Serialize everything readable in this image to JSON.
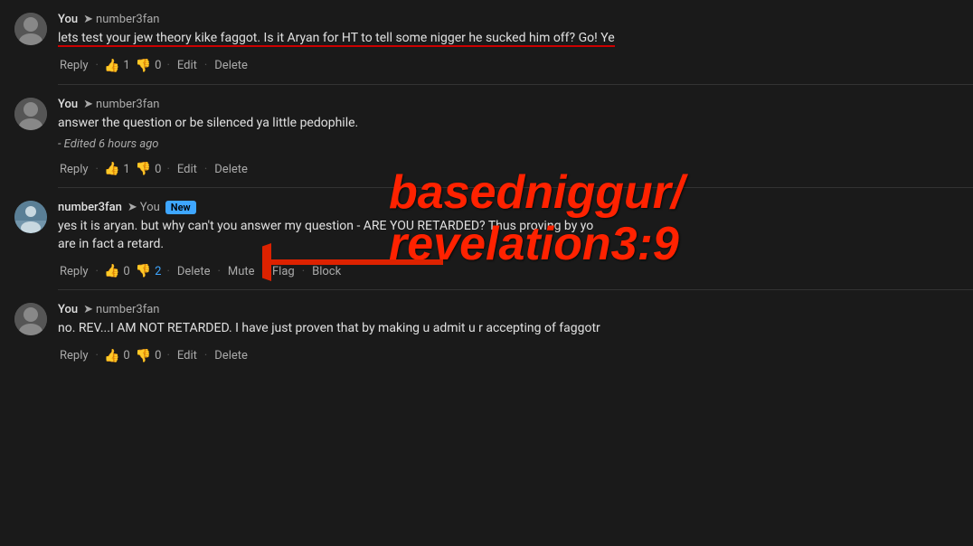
{
  "comments": [
    {
      "id": "comment-1",
      "username": "You",
      "reply_to": "number3fan",
      "text": "lets test your jew theory kike faggot. Is it Aryan for HT to tell some nigger he sucked him off? Go! Ye",
      "highlighted": true,
      "edited": false,
      "actions": [
        "Reply",
        "Edit",
        "Delete"
      ],
      "likes": 1,
      "dislikes": 0,
      "new_badge": false
    },
    {
      "id": "comment-2",
      "username": "You",
      "reply_to": "number3fan",
      "text": "answer the question or be silenced ya little pedophile.",
      "highlighted": false,
      "edited": true,
      "edited_text": "- Edited 6 hours ago",
      "actions": [
        "Reply",
        "Edit",
        "Delete"
      ],
      "likes": 1,
      "dislikes": 0,
      "new_badge": false
    },
    {
      "id": "comment-3",
      "username": "number3fan",
      "reply_to": "You",
      "text": "yes it is aryan. but why can't you answer my question - ARE YOU RETARDED? Thus proving by yo",
      "text_line2": "are in fact a retard.",
      "highlighted": false,
      "edited": false,
      "actions": [
        "Reply",
        "Delete",
        "Mute",
        "Flag",
        "Block"
      ],
      "likes": 0,
      "dislikes": 2,
      "dislikes_highlighted": true,
      "new_badge": true
    },
    {
      "id": "comment-4",
      "username": "You",
      "reply_to": "number3fan",
      "text": "no. REV...I AM NOT RETARDED. I have just proven that by making u admit u r accepting of faggotr",
      "highlighted": false,
      "edited": false,
      "actions": [
        "Reply",
        "Edit",
        "Delete"
      ],
      "likes": 0,
      "dislikes": 0,
      "new_badge": false
    }
  ],
  "watermark": {
    "line1": "basedniggur/",
    "line2": "revelation3:9"
  },
  "labels": {
    "reply": "Reply",
    "edit": "Edit",
    "delete": "Delete",
    "mute": "Mute",
    "flag": "Flag",
    "block": "Block",
    "separator": "·",
    "new": "New"
  }
}
